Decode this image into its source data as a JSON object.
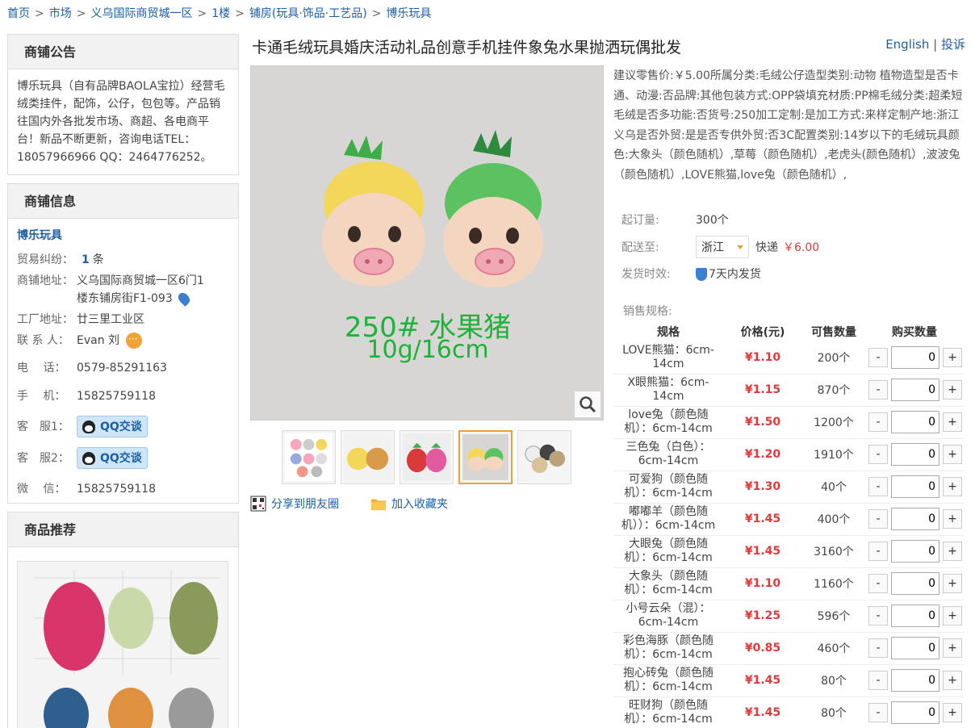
{
  "breadcrumb": [
    "首页",
    "市场",
    "义乌国际商贸城一区",
    "1楼",
    "铺房(玩具·饰品·工艺品)",
    "博乐玩具"
  ],
  "breadcrumb_sep": ">",
  "notice": {
    "title": "商铺公告",
    "text": "博乐玩具（自有品牌BAOLA宝拉）经营毛绒类挂件，配饰，公仔，包包等。产品销往国内外各批发市场、商超、各电商平台！新品不断更新，咨询电话TEL：18057966966 QQ：2464776252。"
  },
  "shop_info": {
    "title": "商铺信息",
    "shop_name": "博乐玩具",
    "dispute_label": "贸易纠纷：",
    "dispute_count": "1",
    "dispute_unit": "条",
    "address_label": "商铺地址：",
    "address_line1": "义乌国际商贸城一区6门1",
    "address_line2": "楼东铺房街F1-093",
    "factory_label": "工厂地址：",
    "factory": "廿三里工业区",
    "contact_label": "联 系 人：",
    "contact": "Evan 刘",
    "phone_label": "电　 话：",
    "phone": "0579-85291163",
    "mobile_label": "手　 机：",
    "mobile": "15825759118",
    "cs1_label": "客　服1：",
    "cs2_label": "客　服2：",
    "qq_btn": "QQ交谈",
    "wechat_label": "微　 信：",
    "wechat": "15825759118"
  },
  "recommend": {
    "title": "商品推荐"
  },
  "product": {
    "title": "卡通毛绒玩具婚庆活动礼品创意手机挂件象兔水果抛洒玩偶批发",
    "lang_english": "English",
    "lang_sep": "|",
    "lang_complain": "投诉",
    "image_caption_line1": "250# 水果猪",
    "image_caption_line2": "10g/16cm",
    "description": "建议零售价:￥5.00所属分类:毛绒公仔造型类别:动物 植物造型是否卡通、动漫:否品牌:其他包装方式:OPP袋填充材质:PP棉毛绒分类:超柔短毛绒是否多功能:否货号:250加工定制:是加工方式:来样定制产地:浙江义乌是否外贸:是是否专供外贸:否3C配置类别:14岁以下的毛绒玩具颜色:大象头（颜色随机）,草莓（颜色随机）,老虎头(颜色随机）,波波兔（颜色随机）,LOVE熊猫,love兔（颜色随机）,",
    "moq_label": "起订量:",
    "moq": "300个",
    "ship_to_label": "配送至:",
    "ship_region": "浙江",
    "express_label": "快递",
    "express_price": "￥6.00",
    "ship_time_label": "发货时效:",
    "ship_time": "7天内发货",
    "share_label": "分享到朋友圈",
    "favorite_label": "加入收藏夹",
    "colors": {
      "price_red": "#e4393c",
      "link_blue": "#1a5fa8",
      "accent_orange": "#e5a13a"
    }
  },
  "spec": {
    "label": "销售规格:",
    "headers": [
      "规格",
      "价格(元)",
      "可售数量",
      "购买数量"
    ],
    "minus": "-",
    "plus": "+",
    "rows": [
      {
        "name": "LOVE熊猫：6cm-14cm",
        "price": "¥1.10",
        "avail": "200个",
        "qty": "0"
      },
      {
        "name": "X眼熊猫：6cm-14cm",
        "price": "¥1.15",
        "avail": "870个",
        "qty": "0"
      },
      {
        "name": "love兔（颜色随机）：6cm-14cm",
        "price": "¥1.50",
        "avail": "1200个",
        "qty": "0"
      },
      {
        "name": "三色兔（白色）：6cm-14cm",
        "price": "¥1.20",
        "avail": "1910个",
        "qty": "0"
      },
      {
        "name": "可爱狗（颜色随机）：6cm-14cm",
        "price": "¥1.30",
        "avail": "40个",
        "qty": "0"
      },
      {
        "name": "嘟嘟羊（颜色随机））：6cm-14cm",
        "price": "¥1.45",
        "avail": "400个",
        "qty": "0"
      },
      {
        "name": "大眼兔（颜色随机）：6cm-14cm",
        "price": "¥1.45",
        "avail": "3160个",
        "qty": "0"
      },
      {
        "name": "大象头（颜色随机）：6cm-14cm",
        "price": "¥1.10",
        "avail": "1160个",
        "qty": "0"
      },
      {
        "name": "小号云朵（混）：6cm-14cm",
        "price": "¥1.25",
        "avail": "596个",
        "qty": "0"
      },
      {
        "name": "彩色海豚（颜色随机）：6cm-14cm",
        "price": "¥0.85",
        "avail": "460个",
        "qty": "0"
      },
      {
        "name": "抱心砖兔（颜色随机）：6cm-14cm",
        "price": "¥1.45",
        "avail": "80个",
        "qty": "0"
      },
      {
        "name": "旺财狗（颜色随机）：6cm-14cm",
        "price": "¥1.45",
        "avail": "80个",
        "qty": "0"
      }
    ]
  }
}
